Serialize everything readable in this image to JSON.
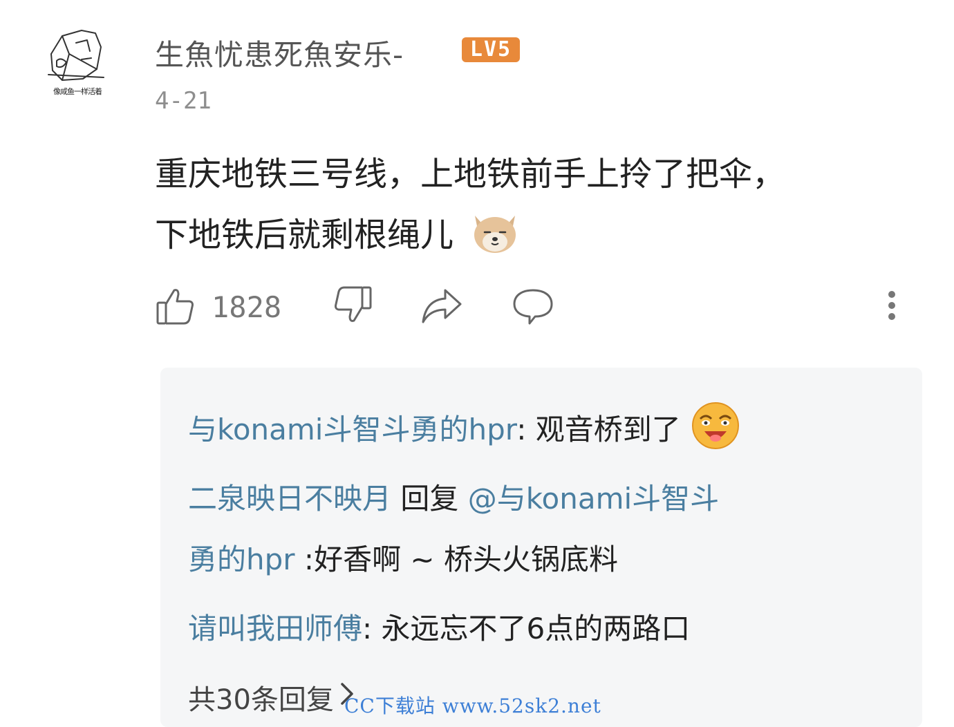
{
  "post": {
    "username": "生魚忧患死魚安乐-",
    "level_badge": "LV5",
    "avatar_caption": "像咸鱼一样活着",
    "date": "4-21",
    "content_line1": "重庆地铁三号线，上地铁前手上拎了把伞，",
    "content_line2": "下地铁后就剩根绳儿",
    "like_count": "1828"
  },
  "replies": [
    {
      "nick": "与konami斗智斗勇的hpr",
      "separator": ": ",
      "text": "观音桥到了"
    },
    {
      "nick": "二泉映日不映月",
      "reply_word": " 回复 ",
      "at": "@与konami斗智斗",
      "at_cont": "勇的hpr",
      "text": " :好香啊 ~ 桥头火锅底料"
    },
    {
      "nick": "请叫我田师傅",
      "separator": ": ",
      "text": "永远忘不了6点的两路口"
    }
  ],
  "more_replies_label": "共30条回复",
  "watermark": "CC下载站 www.52sk2.net",
  "colors": {
    "nick": "#4a7ea0",
    "badge": "#e8893a",
    "watermark": "#3d7fd6",
    "reply_bg": "#f5f6f7"
  },
  "icons": [
    "thumbs-up-icon",
    "thumbs-down-icon",
    "share-icon",
    "comment-icon",
    "more-vertical-icon",
    "chevron-right-icon",
    "shiba-emoji-icon",
    "laughing-emoji-icon"
  ]
}
